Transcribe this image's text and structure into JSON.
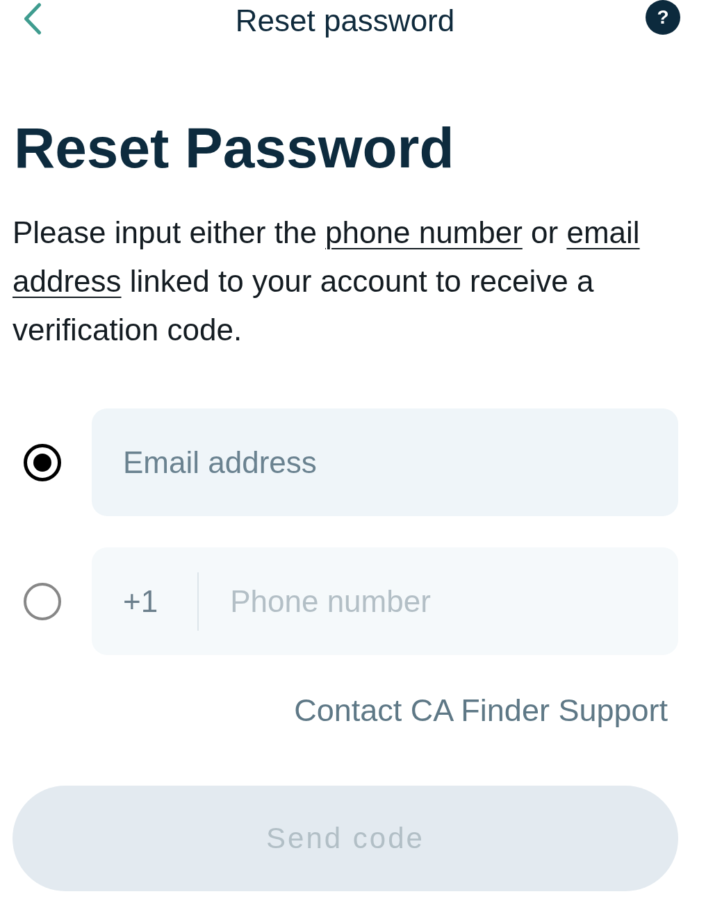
{
  "header": {
    "title": "Reset password",
    "help_button": "?"
  },
  "heading": "Reset Password",
  "instructions": [
    {
      "kind": "text",
      "text": "Please input either the "
    },
    {
      "kind": "link",
      "text": "phone number"
    },
    {
      "kind": "text",
      "text": " or "
    },
    {
      "kind": "link",
      "text": "email address"
    },
    {
      "kind": "text",
      "text": " linked to your account to receive a verification code."
    }
  ],
  "options": [
    {
      "kind": "email",
      "selected": true,
      "placeholder": "Email address"
    },
    {
      "kind": "phone",
      "selected": false,
      "country_code": "+1",
      "placeholder": "Phone number"
    }
  ],
  "support_link": "Contact CA Finder Support",
  "send_button": {
    "label": "Send code",
    "disabled": true
  }
}
